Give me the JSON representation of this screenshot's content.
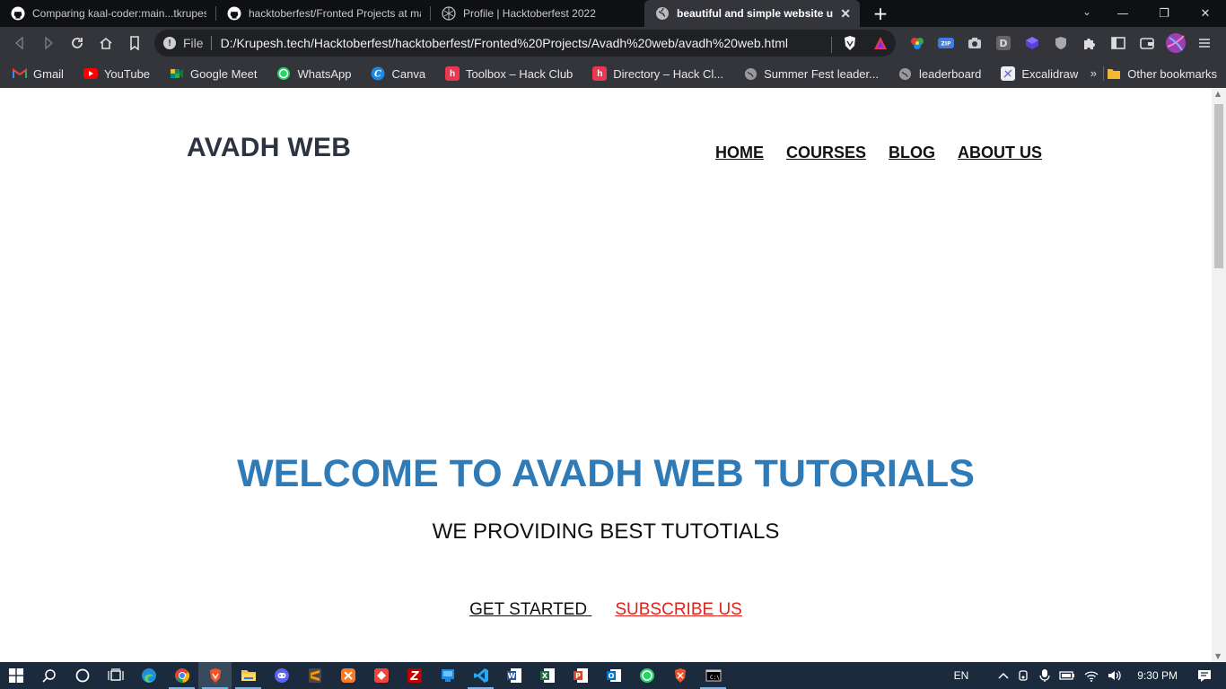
{
  "browser": {
    "tabs": [
      {
        "title": "Comparing kaal-coder:main...tkrupesh",
        "icon": "github-icon",
        "active": false
      },
      {
        "title": "hacktoberfest/Fronted Projects at main",
        "icon": "github-icon",
        "active": false
      },
      {
        "title": "Profile | Hacktoberfest 2022",
        "icon": "globe-icon",
        "active": false
      },
      {
        "title": "beautiful and simple website using",
        "icon": "globe-icon",
        "active": true
      }
    ],
    "new_tab": "+",
    "address": {
      "scheme_label": "File",
      "url": "D:/Krupesh.tech/Hacktoberfest/hacktoberfest/Fronted%20Projects/Avadh%20web/avadh%20web.html"
    },
    "bookmarks": [
      {
        "label": "Gmail",
        "icon": "gmail-icon",
        "color": "#ea4335"
      },
      {
        "label": "YouTube",
        "icon": "youtube-icon",
        "color": "#ff0000"
      },
      {
        "label": "Google Meet",
        "icon": "meet-icon",
        "color": "#00897b"
      },
      {
        "label": "WhatsApp",
        "icon": "whatsapp-icon",
        "color": "#25d366"
      },
      {
        "label": "Canva",
        "icon": "canva-icon",
        "color": "#1e88e5"
      },
      {
        "label": "Toolbox – Hack Club",
        "icon": "hackclub-icon",
        "color": "#ec3750"
      },
      {
        "label": "Directory – Hack Cl...",
        "icon": "hackclub-icon",
        "color": "#ec3750"
      },
      {
        "label": "Summer Fest leader...",
        "icon": "globe-icon",
        "color": "#888888"
      },
      {
        "label": "leaderboard",
        "icon": "globe-icon",
        "color": "#888888"
      },
      {
        "label": "Excalidraw",
        "icon": "excalidraw-icon",
        "color": "#eeeeee"
      }
    ],
    "bookmarks_more": "»",
    "other_bookmarks": "Other bookmarks"
  },
  "page": {
    "logo": "AVADH WEB",
    "nav": [
      "HOME",
      "COURSES",
      "BLOG",
      "ABOUT US"
    ],
    "hero_title": "WELCOME TO AVADH WEB TUTORIALS",
    "hero_subtitle": "WE PROVIDING BEST TUTOTIALS",
    "cta_primary": "GET STARTED ",
    "cta_secondary": "SUBSCRIBE US",
    "colors": {
      "title": "#2f7bb7",
      "subscribe": "#e3221b",
      "logo": "#2b3440"
    }
  },
  "taskbar": {
    "apps": [
      "start-icon",
      "search-icon",
      "cortana-icon",
      "task-view-icon",
      "edge-icon",
      "chrome-icon",
      "brave-icon",
      "file-explorer-icon",
      "discord-icon",
      "sublime-icon",
      "xampp-icon",
      "anydesk-icon",
      "filezilla-icon",
      "vmware-icon",
      "vscode-icon",
      "word-icon",
      "excel-icon",
      "powerpoint-icon",
      "outlook-icon",
      "whatsapp-icon",
      "brave-nightly-icon",
      "cmd-icon"
    ],
    "language": "EN",
    "time": "9:30 PM"
  }
}
